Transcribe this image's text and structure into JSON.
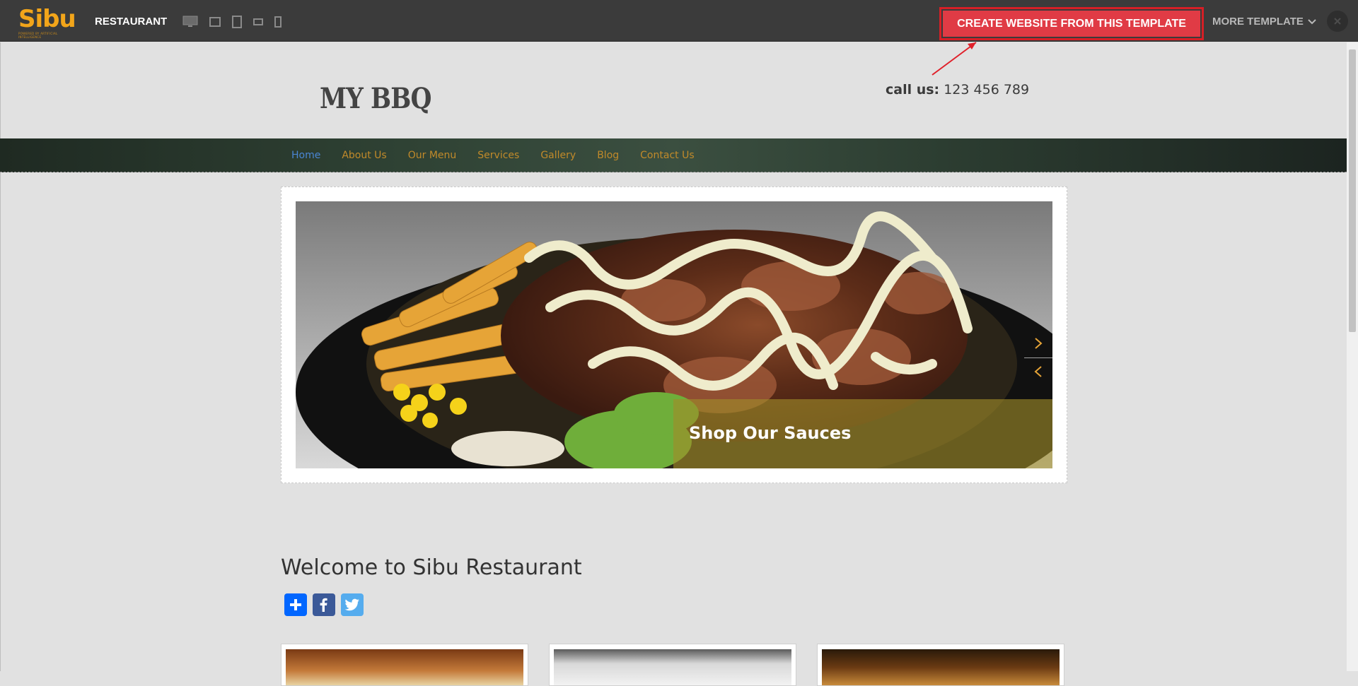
{
  "topbar": {
    "logo_text": "Sibu",
    "logo_tagline": "POWERED BY ARTIFICIAL INTELLIGENCE",
    "template_name": "RESTAURANT",
    "devices": [
      "desktop-icon",
      "tablet-landscape-icon",
      "tablet-portrait-icon",
      "phone-landscape-icon",
      "phone-portrait-icon"
    ],
    "cta_label": "CREATE WEBSITE FROM THIS TEMPLATE",
    "more_label": "MORE TEMPLATE",
    "colors": {
      "bar": "#3b3b3b",
      "cta": "#e03b45",
      "highlight": "#d61f26",
      "logo": "#f2a51a"
    }
  },
  "site": {
    "title": "MY BBQ",
    "call_label": "call us:",
    "phone": "123 456 789",
    "nav": [
      "Home",
      "About Us",
      "Our Menu",
      "Services",
      "Gallery",
      "Blog",
      "Contact Us"
    ],
    "slider_caption": "Shop Our Sauces",
    "welcome": "Welcome to Sibu Restaurant",
    "share_icons": [
      "share-plus-icon",
      "facebook-icon",
      "twitter-icon"
    ],
    "colors": {
      "nav_link": "#c18a2a",
      "nav_active": "#4a86d4"
    }
  }
}
